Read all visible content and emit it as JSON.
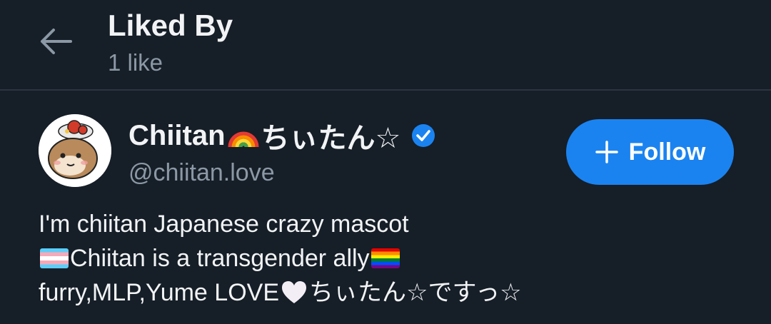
{
  "header": {
    "title": "Liked By",
    "subtitle": "1 like"
  },
  "user": {
    "name_prefix": "Chiitan",
    "name_suffix": "ちぃたん☆",
    "handle": "@chiitan.love",
    "verified": true,
    "follow_label": "Follow"
  },
  "bio": {
    "line1": "I'm chiitan Japanese crazy mascot",
    "line2": "Chiitan is a transgender ally",
    "line3_a": "furry,MLP,Yume LOVE",
    "line3_b": "ちぃたん☆ですっ☆"
  },
  "colors": {
    "background": "#161e27",
    "accent": "#1b83f0",
    "muted_text": "#8b98a5"
  }
}
